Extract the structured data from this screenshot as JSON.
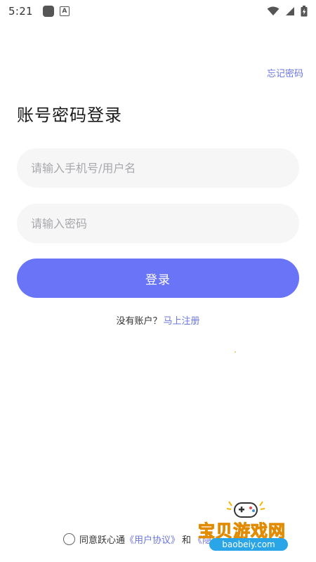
{
  "status_bar": {
    "time": "5:21",
    "app_badge_letter": "A"
  },
  "header": {
    "forgot_password": "忘记密码"
  },
  "page": {
    "title": "账号密码登录"
  },
  "form": {
    "username_placeholder": "请输入手机号/用户名",
    "username_value": "",
    "password_placeholder": "请输入密码",
    "password_value": "",
    "login_label": "登录"
  },
  "register": {
    "prompt": "没有账户？",
    "link": "马上注册"
  },
  "agreement": {
    "prefix": "同意跃心通",
    "user_agreement": "《用户协议》",
    "and": "和",
    "privacy_partial": "《隐"
  },
  "watermark": {
    "title": "宝贝游戏网",
    "url": "baobeiy.com"
  },
  "colors": {
    "accent": "#6a74f6",
    "link": "#6b74e0",
    "field_bg": "#f6f6f7"
  }
}
